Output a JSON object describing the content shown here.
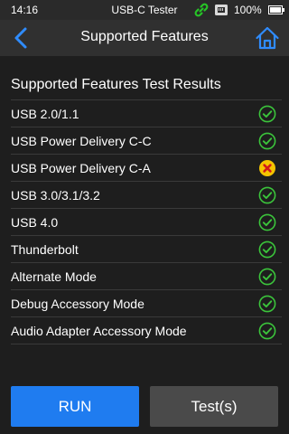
{
  "status_bar": {
    "time": "14:16",
    "app_name": "USB-C Tester",
    "battery": "100%"
  },
  "header": {
    "title": "Supported Features"
  },
  "section_title": "Supported Features Test Results",
  "features": [
    {
      "label": "USB 2.0/1.1",
      "status": "pass"
    },
    {
      "label": "USB Power Delivery C-C",
      "status": "pass"
    },
    {
      "label": "USB Power Delivery C-A",
      "status": "fail"
    },
    {
      "label": "USB 3.0/3.1/3.2",
      "status": "pass"
    },
    {
      "label": "USB 4.0",
      "status": "pass"
    },
    {
      "label": "Thunderbolt",
      "status": "pass"
    },
    {
      "label": "Alternate Mode",
      "status": "pass"
    },
    {
      "label": "Debug Accessory Mode",
      "status": "pass"
    },
    {
      "label": "Audio Adapter Accessory Mode",
      "status": "pass"
    }
  ],
  "buttons": {
    "run": "RUN",
    "tests": "Test(s)"
  },
  "colors": {
    "accent": "#1f7cf0",
    "pass": "#3bc43b",
    "fail_fill": "#f5c400",
    "fail_mark": "#d11a1a",
    "link_icon": "#26c526"
  }
}
